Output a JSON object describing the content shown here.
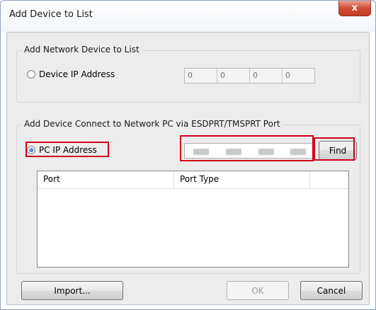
{
  "window": {
    "title": "Add Device to List",
    "close_glyph": "x"
  },
  "network_group": {
    "title": "Add Network Device to List",
    "radio_label": "Device IP Address",
    "radio_checked": false,
    "ip": [
      "0",
      "0",
      "0",
      "0"
    ]
  },
  "pc_group": {
    "title": "Add Device Connect to Network PC via ESDPRT/TMSPRT Port",
    "radio_label": "PC IP Address",
    "radio_checked": true,
    "find_label": "Find",
    "columns": [
      "Port",
      "Port Type",
      ""
    ]
  },
  "footer": {
    "import_label": "Import...",
    "ok_label": "OK",
    "cancel_label": "Cancel"
  },
  "colors": {
    "highlight": "#d0021b",
    "close": "#c43a22"
  }
}
